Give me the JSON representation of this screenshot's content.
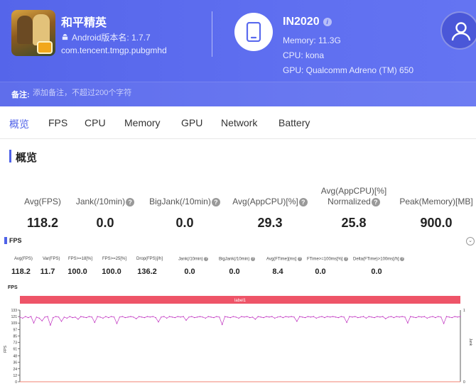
{
  "app": {
    "name": "和平精英",
    "version_label": "Android版本名: 1.7.7",
    "package": "com.tencent.tmgp.pubgmhd"
  },
  "device": {
    "name": "IN2020",
    "memory": "Memory: 11.3G",
    "cpu": "CPU: kona",
    "gpu": "GPU: Qualcomm Adreno (TM) 650"
  },
  "note": {
    "label": "备注:",
    "placeholder": "添加备注，不超过200个字符"
  },
  "tabs": [
    "概览",
    "FPS",
    "CPU",
    "Memory",
    "GPU",
    "Network",
    "Battery"
  ],
  "active_tab": 0,
  "section": {
    "title": "概览"
  },
  "metrics": [
    {
      "label": "Avg(FPS)",
      "value": "118.2"
    },
    {
      "label": "Jank(/10min)",
      "value": "0.0"
    },
    {
      "label": "BigJank(/10min)",
      "value": "0.0"
    },
    {
      "label": "Avg(AppCPU)[%]",
      "value": "29.3"
    },
    {
      "label_line1": "Avg(AppCPU)[%]",
      "label_line2": "Normalized",
      "value": "25.8"
    },
    {
      "label": "Peak(Memory)[MB]",
      "value": "900.0"
    }
  ],
  "fps_panel": {
    "title": "FPS",
    "collapse": "⌄",
    "stats": [
      {
        "label": "Avg(FPS)",
        "value": "118.2"
      },
      {
        "label": "Var(FPS)",
        "value": "11.7"
      },
      {
        "label": "FPS>=18[%]",
        "value": "100.0"
      },
      {
        "label": "FPS>=25[%]",
        "value": "100.0"
      },
      {
        "label": "Drop(FPS)[/h]",
        "value": "136.2"
      },
      {
        "label": "Jank(/10min)",
        "value": "0.0"
      },
      {
        "label": "BigJank(/10min)",
        "value": "0.0"
      },
      {
        "label": "Avg(FTime)[ms]",
        "value": "8.4"
      },
      {
        "label": "FTime>=100ms[%]",
        "value": "0.0"
      },
      {
        "label": "Delta(FTime)>100ms[/h]",
        "value": "0.0"
      }
    ]
  },
  "chart_data": {
    "type": "line",
    "title": "FPS",
    "label_band": "label1",
    "ylabel": "FPS",
    "ylabel_right": "Jank",
    "yticks": [
      "133",
      "121",
      "109",
      "97",
      "85",
      "73",
      "61",
      "48",
      "36",
      "24",
      "12",
      "0"
    ],
    "yticks_right": [
      "1",
      "0"
    ],
    "ylim": [
      0,
      133
    ],
    "series": [
      {
        "color": "#c030c0",
        "values": [
          120,
          118,
          121,
          119,
          121,
          109,
          120,
          118,
          113,
          120,
          121,
          105,
          119,
          121,
          120,
          112,
          120,
          118,
          121,
          119,
          120,
          116,
          121,
          120,
          119,
          121,
          120,
          110,
          121,
          120,
          118,
          121,
          119,
          121,
          120,
          108,
          120,
          121,
          119,
          120,
          121,
          120,
          117,
          121,
          120,
          119,
          121,
          120,
          121,
          119,
          111,
          120,
          121,
          118,
          121,
          120,
          119,
          121,
          120,
          121,
          114,
          120,
          121,
          119,
          120,
          121,
          120,
          118,
          121,
          120,
          119,
          121,
          120,
          106,
          121,
          120,
          119,
          121,
          120,
          118,
          121,
          120,
          121,
          119,
          120,
          116,
          121,
          120,
          119,
          121,
          120,
          121,
          118,
          120,
          121,
          119,
          121,
          120,
          121,
          120,
          112,
          121,
          120,
          119,
          121,
          120,
          121,
          118,
          120,
          121,
          119,
          121,
          120,
          121,
          120,
          119,
          121,
          120,
          110,
          121,
          120,
          121,
          119,
          120,
          121,
          118,
          121,
          120,
          119,
          121,
          120,
          121,
          117,
          120,
          121,
          119,
          121,
          120,
          121,
          120,
          109,
          121,
          120,
          119,
          121,
          120,
          121,
          118,
          120,
          121,
          119,
          121,
          120,
          108,
          121,
          120,
          119,
          121,
          120,
          121
        ]
      },
      {
        "color": "#f08070",
        "values": [
          0,
          0,
          0,
          0,
          0,
          0,
          0,
          0,
          0,
          0,
          0,
          0,
          0,
          0,
          0,
          0,
          0,
          0,
          0,
          0,
          0,
          0,
          0,
          0,
          0,
          0,
          0,
          0,
          0,
          0,
          0,
          0,
          0,
          0,
          0,
          0,
          0,
          0,
          0,
          0,
          0,
          0,
          0,
          0,
          0,
          0,
          0,
          0,
          0,
          0,
          0,
          0,
          0,
          0,
          0,
          0,
          0,
          0,
          0,
          0,
          0,
          0,
          0,
          0,
          0,
          0,
          0,
          0,
          0,
          0,
          0,
          0,
          0,
          0,
          0,
          0,
          0,
          0,
          0,
          0,
          0,
          0,
          0,
          0,
          0,
          0,
          0,
          0,
          0,
          0,
          0,
          0,
          0,
          0,
          0,
          0,
          0,
          0,
          0,
          0,
          0,
          0,
          0,
          0,
          0,
          0,
          0,
          0,
          0,
          0,
          0,
          0,
          0,
          0,
          0,
          0,
          0,
          0,
          0,
          0,
          0,
          0,
          0,
          0,
          0,
          0,
          0,
          0,
          0,
          0,
          0,
          0,
          0,
          0,
          0,
          0,
          0,
          0,
          0,
          0,
          0,
          0,
          0,
          0,
          0,
          0,
          0,
          0,
          0,
          0,
          0,
          0,
          0,
          0,
          0,
          0,
          0,
          0,
          0,
          0,
          0,
          0,
          0,
          0,
          0
        ]
      }
    ]
  },
  "colors": {
    "accent": "#4f62e8",
    "header": "#5a6aee",
    "label_band": "#ee5468"
  },
  "icons": {
    "android": "android-icon",
    "phone": "phone-icon",
    "user": "user-icon",
    "info": "info-icon",
    "help": "help-icon"
  }
}
